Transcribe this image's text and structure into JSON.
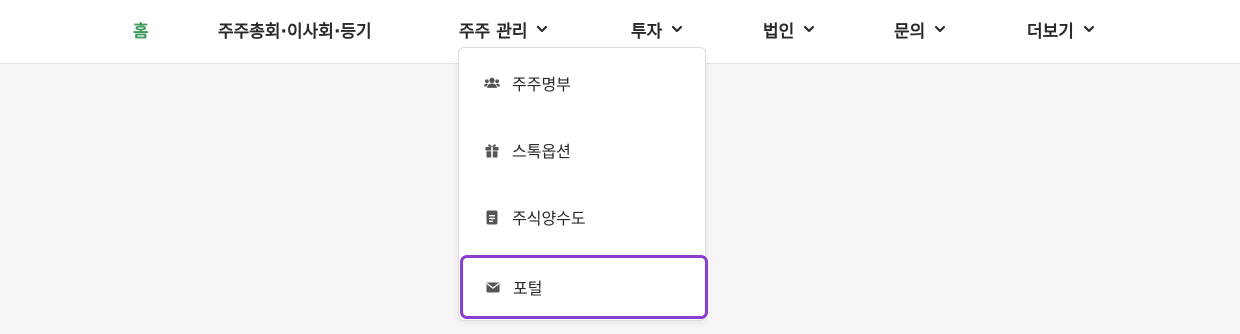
{
  "nav": {
    "items": [
      {
        "label": "홈",
        "has_dropdown": false
      },
      {
        "label": "주주총회·이사회·등기",
        "has_dropdown": false
      },
      {
        "label": "주주 관리",
        "has_dropdown": true
      },
      {
        "label": "투자",
        "has_dropdown": true
      },
      {
        "label": "법인",
        "has_dropdown": true
      },
      {
        "label": "문의",
        "has_dropdown": true
      },
      {
        "label": "더보기",
        "has_dropdown": true
      }
    ]
  },
  "dropdown": {
    "parent": "주주 관리",
    "items": [
      {
        "label": "주주명부",
        "icon": "users-icon"
      },
      {
        "label": "스톡옵션",
        "icon": "gift-icon"
      },
      {
        "label": "주식양수도",
        "icon": "document-icon"
      },
      {
        "label": "포털",
        "icon": "envelope-icon",
        "highlighted": true
      }
    ]
  },
  "colors": {
    "active_home": "#3e9a5a",
    "highlight_border": "#8d3cd0",
    "text": "#2a2a2a",
    "background": "#f5f5f5"
  }
}
